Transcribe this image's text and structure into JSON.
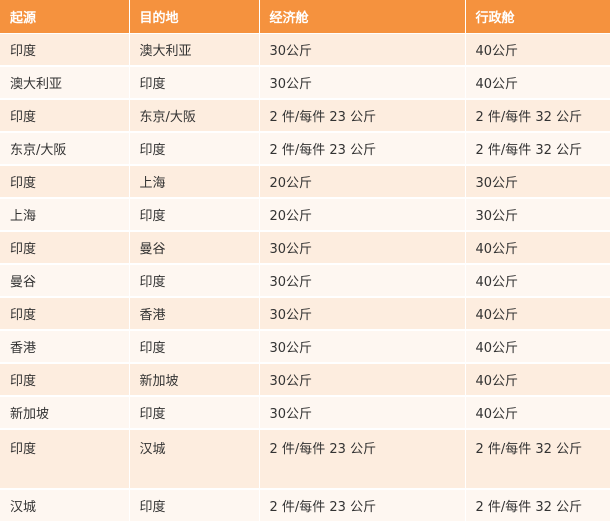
{
  "table": {
    "headers": [
      "起源",
      "目的地",
      "经济舱",
      "行政舱"
    ],
    "rows": [
      [
        "印度",
        "澳大利亚",
        "30公斤",
        "40公斤"
      ],
      [
        "澳大利亚",
        "印度",
        "30公斤",
        "40公斤"
      ],
      [
        "印度",
        "东京/大阪",
        "2 件/每件 23 公斤",
        "2 件/每件 32 公斤"
      ],
      [
        "东京/大阪",
        "印度",
        "2 件/每件 23 公斤",
        "2 件/每件 32 公斤"
      ],
      [
        "印度",
        "上海",
        "20公斤",
        "30公斤"
      ],
      [
        "上海",
        "印度",
        "20公斤",
        "30公斤"
      ],
      [
        "印度",
        "曼谷",
        "30公斤",
        "40公斤"
      ],
      [
        "曼谷",
        "印度",
        "30公斤",
        "40公斤"
      ],
      [
        "印度",
        "香港",
        "30公斤",
        "40公斤"
      ],
      [
        "香港",
        "印度",
        "30公斤",
        "40公斤"
      ],
      [
        "印度",
        "新加坡",
        "30公斤",
        "40公斤"
      ],
      [
        "新加坡",
        "印度",
        "30公斤",
        "40公斤"
      ],
      [
        "印度",
        "汉城",
        "2 件/每件 23 公斤",
        "2 件/每件 32 公斤"
      ],
      [
        "汉城",
        "印度",
        "2 件/每件 23 公斤",
        "2 件/每件 32 公斤"
      ]
    ]
  },
  "colors": {
    "header_bg": "#f5923e",
    "row_odd_bg": "#fdeddf",
    "row_even_bg": "#fef7f1"
  }
}
